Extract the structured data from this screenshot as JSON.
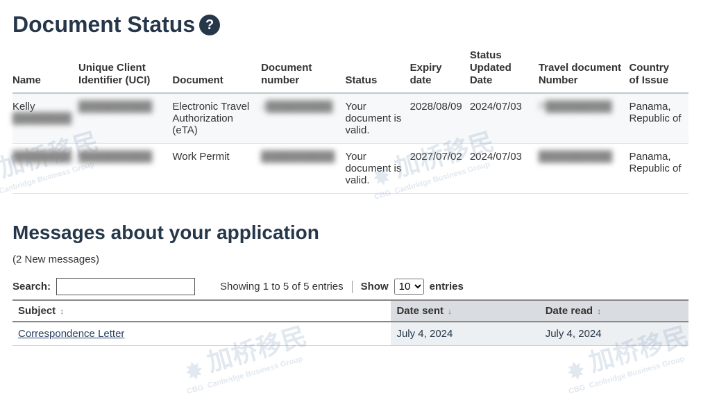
{
  "document_status": {
    "title": "Document Status",
    "help_label": "?",
    "headers": {
      "name": "Name",
      "uci": "Unique Client Identifier (UCI)",
      "document": "Document",
      "doc_number": "Document number",
      "status": "Status",
      "expiry": "Expiry date",
      "updated": "Status Updated Date",
      "travel_doc": "Travel document Number",
      "country": "Country of Issue"
    },
    "rows": [
      {
        "name_visible": "Kelly",
        "name_redacted": "████████",
        "uci": "██████████",
        "document": "Electronic Travel Authorization (eTA)",
        "doc_number": "J█████████",
        "status": "Your document is valid.",
        "expiry": "2028/08/09",
        "updated": "2024/07/03",
        "travel_doc": "P█████████",
        "country": "Panama, Republic of"
      },
      {
        "name_visible": "",
        "name_redacted": "████████",
        "uci": "██████████",
        "document": "Work Permit",
        "doc_number": "██████████",
        "status": "Your document is valid.",
        "expiry": "2027/07/02",
        "updated": "2024/07/03",
        "travel_doc": "██████████",
        "country": "Panama, Republic of"
      }
    ]
  },
  "messages": {
    "title": "Messages about your application",
    "new_count": "(2 New messages)",
    "search_label": "Search:",
    "search_value": "",
    "showing_text": "Showing 1 to 5 of 5 entries",
    "show_label": "Show",
    "entries_label": "entries",
    "per_page": "10",
    "headers": {
      "subject": "Subject",
      "sent": "Date sent",
      "read": "Date read"
    },
    "rows": [
      {
        "subject": "Correspondence Letter",
        "sent": "July 4, 2024",
        "read": "July 4, 2024"
      }
    ]
  },
  "watermark": {
    "cn": "加桥移民",
    "en": "Canbridge Business Group",
    "tag": "CBG"
  }
}
